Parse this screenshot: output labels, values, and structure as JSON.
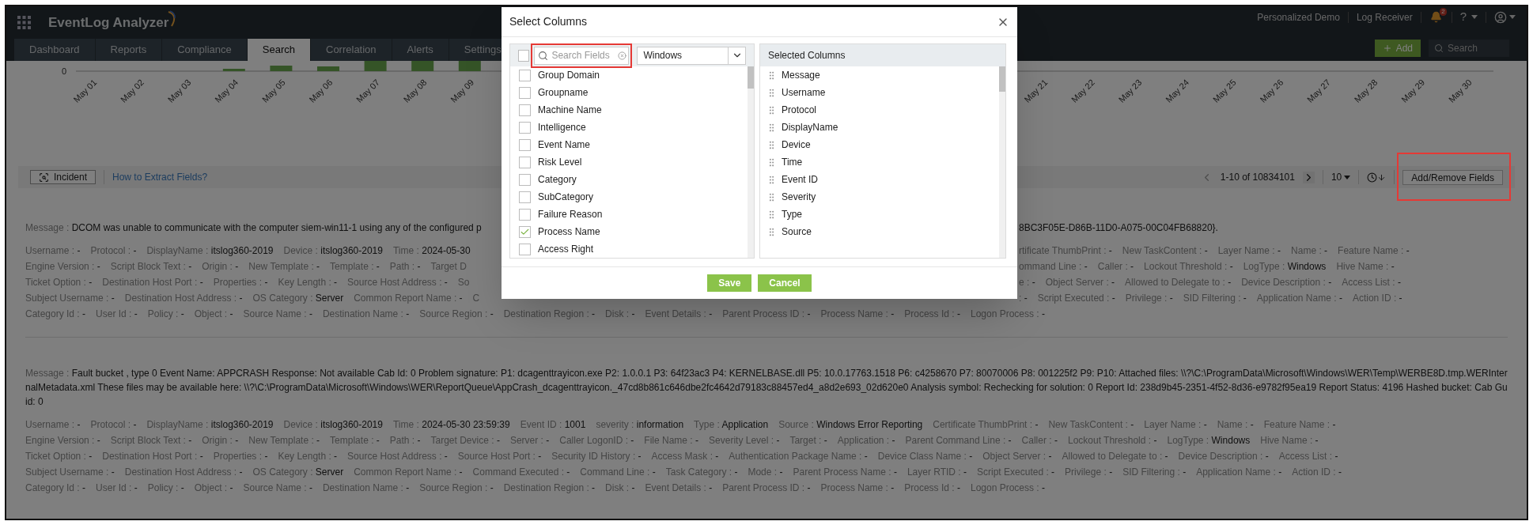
{
  "header": {
    "app_name": "EventLog Analyzer",
    "links": [
      "Personalized Demo",
      "Log Receiver"
    ],
    "notification_badge": "2",
    "help_label": "?",
    "add_button": "Add",
    "search_placeholder": "Search"
  },
  "tabs": [
    {
      "label": "Dashboard",
      "selected": false
    },
    {
      "label": "Reports",
      "selected": false
    },
    {
      "label": "Compliance",
      "selected": false
    },
    {
      "label": "Search",
      "selected": true
    },
    {
      "label": "Correlation",
      "selected": false
    },
    {
      "label": "Alerts",
      "selected": false
    },
    {
      "label": "Settings",
      "selected": false
    }
  ],
  "chart": {
    "zero_label": "0",
    "x_labels_left": [
      "May 01",
      "May 02",
      "May 03",
      "May 04",
      "May 05",
      "May 06",
      "May 07",
      "May 08",
      "May 09"
    ],
    "x_labels_right": [
      "May 21",
      "May 22",
      "May 23",
      "May 24",
      "May 25",
      "May 26",
      "May 27",
      "May 28",
      "May 29",
      "May 30"
    ]
  },
  "results_bar": {
    "incident_button": "Incident",
    "help_link": "How to Extract Fields?",
    "range": "1-10 of 10834101",
    "page_size": "10",
    "add_remove_button": "Add/Remove Fields"
  },
  "records": [
    {
      "message_label": "Message :",
      "message_left": "DCOM was unable to communicate with the computer siem-win11-1 using any of the configured p",
      "message_right": "8BC3F05E-D86B-11D0-A075-00C04FB68820}.",
      "lines": [
        {
          "left": [
            {
              "label": "Username :",
              "value": "-"
            },
            {
              "label": "Protocol :",
              "value": "-"
            },
            {
              "label": "DisplayName :",
              "value": "itslog360-2019"
            },
            {
              "label": "Device :",
              "value": "itslog360-2019"
            },
            {
              "label": "Time :",
              "value": "2024-05-30"
            }
          ],
          "right": [
            {
              "label": "rtificate ThumbPrint :",
              "value": "-"
            },
            {
              "label": "New TaskContent :",
              "value": "-"
            },
            {
              "label": "Layer Name :",
              "value": "-"
            },
            {
              "label": "Name :",
              "value": "-"
            },
            {
              "label": "Feature Name :",
              "value": "-"
            }
          ]
        },
        {
          "left": [
            {
              "label": "Engine Version :",
              "value": "-"
            },
            {
              "label": "Script Block Text :",
              "value": "-"
            },
            {
              "label": "Origin :",
              "value": "-"
            },
            {
              "label": "New Template :",
              "value": "-"
            },
            {
              "label": "Template :",
              "value": "-"
            },
            {
              "label": "Path :",
              "value": "-"
            },
            {
              "label": "Target D"
            }
          ],
          "right": [
            {
              "label": "ommand Line :",
              "value": "-"
            },
            {
              "label": "Caller :",
              "value": "-"
            },
            {
              "label": "Lockout Threshold :",
              "value": "-"
            },
            {
              "label": "LogType :",
              "value": "Windows"
            },
            {
              "label": "Hive Name :",
              "value": "-"
            }
          ]
        },
        {
          "left": [
            {
              "label": "Ticket Option :",
              "value": "-"
            },
            {
              "label": "Destination Host Port :",
              "value": "-"
            },
            {
              "label": "Properties :",
              "value": "-"
            },
            {
              "label": "Key Length :",
              "value": "-"
            },
            {
              "label": "Source Host Address :",
              "value": "-"
            },
            {
              "label": "So"
            }
          ],
          "right": [
            {
              "label": "e :",
              "value": "-"
            },
            {
              "label": "Object Server :",
              "value": "-"
            },
            {
              "label": "Allowed to Delegate to :",
              "value": "-"
            },
            {
              "label": "Device Description :",
              "value": "-"
            },
            {
              "label": "Access List :",
              "value": "-"
            }
          ]
        },
        {
          "left": [
            {
              "label": "Subject Username :",
              "value": "-"
            },
            {
              "label": "Destination Host Address :",
              "value": "-"
            },
            {
              "label": "OS Category :",
              "value": "Server"
            },
            {
              "label": "Common Report Name :",
              "value": "-"
            },
            {
              "label": "C"
            }
          ],
          "right": [
            {
              "label": ":",
              "value": "-"
            },
            {
              "label": "Script Executed :",
              "value": "-"
            },
            {
              "label": "Privilege :",
              "value": "-"
            },
            {
              "label": "SID Filtering :",
              "value": "-"
            },
            {
              "label": "Application Name :",
              "value": "-"
            },
            {
              "label": "Action ID :",
              "value": "-"
            }
          ]
        },
        {
          "left": [
            {
              "label": "Category Id :",
              "value": "-"
            },
            {
              "label": "User Id :",
              "value": "-"
            },
            {
              "label": "Policy :",
              "value": "-"
            },
            {
              "label": "Object :",
              "value": "-"
            },
            {
              "label": "Source Name :",
              "value": "-"
            },
            {
              "label": "Destination Name :",
              "value": "-"
            },
            {
              "label": "Source Region :",
              "value": "-"
            },
            {
              "label": "Destination Region :",
              "value": "-"
            },
            {
              "label": "Disk :",
              "value": "-"
            },
            {
              "label": "Event Details :",
              "value": "-"
            },
            {
              "label": "Parent Process ID :",
              "value": "-"
            },
            {
              "label": "Process Name :",
              "value": "-"
            },
            {
              "label": "Process Id :",
              "value": "-"
            },
            {
              "label": "Logon Process :",
              "value": "-"
            }
          ]
        }
      ]
    },
    {
      "message_label": "Message :",
      "message_left": "Fault bucket , type 0 Event Name: APPCRASH Response: Not available Cab Id: 0 Problem signature: P1: dcagenttrayicon.exe P2: 1.0.0.1 P3: 64f23ac3 P4: KERNELBASE.dll P5: 10.0.17763.1518 P6: c4258670 P7: 80070006 P8: 001225f2 P9: P10: Attached files: \\\\?\\C:\\ProgramData\\Microsoft\\Windows\\WER\\Temp\\WERBE8D.tmp.WERInternalMetadata.xml These files may be available here: \\\\?\\C:\\ProgramData\\Microsoft\\Windows\\WER\\ReportQueue\\AppCrash_dcagenttrayicon._47cd8b861c646dbe2fc4642d79183c88457ed4_a8d2e693_02d620e0 Analysis symbol: Rechecking for solution: 0 Report Id: 238d9b45-2351-4f52-8d36-e9782f95ea19 Report Status: 4196 Hashed bucket: Cab Guid: 0",
      "lines": [
        {
          "left": [
            {
              "label": "Username :",
              "value": "-"
            },
            {
              "label": "Protocol :",
              "value": "-"
            },
            {
              "label": "DisplayName :",
              "value": "itslog360-2019"
            },
            {
              "label": "Device :",
              "value": "itslog360-2019"
            },
            {
              "label": "Time :",
              "value": "2024-05-30 23:59:39"
            },
            {
              "label": "Event ID :",
              "value": "1001"
            },
            {
              "label": "severity :",
              "value": "information"
            },
            {
              "label": "Type :",
              "value": "Application"
            },
            {
              "label": "Source :",
              "value": "Windows Error Reporting"
            },
            {
              "label": "Certificate ThumbPrint :",
              "value": "-"
            },
            {
              "label": "New TaskContent :",
              "value": "-"
            },
            {
              "label": "Layer Name :",
              "value": "-"
            },
            {
              "label": "Name :",
              "value": "-"
            },
            {
              "label": "Feature Name :",
              "value": "-"
            }
          ]
        },
        {
          "left": [
            {
              "label": "Engine Version :",
              "value": "-"
            },
            {
              "label": "Script Block Text :",
              "value": "-"
            },
            {
              "label": "Origin :",
              "value": "-"
            },
            {
              "label": "New Template :",
              "value": "-"
            },
            {
              "label": "Template :",
              "value": "-"
            },
            {
              "label": "Path :",
              "value": "-"
            },
            {
              "label": "Target Device :",
              "value": "-"
            },
            {
              "label": "Server :",
              "value": "-"
            },
            {
              "label": "Caller LogonID :",
              "value": "-"
            },
            {
              "label": "File Name :",
              "value": "-"
            },
            {
              "label": "Severity Level :",
              "value": "-"
            },
            {
              "label": "Target :",
              "value": "-"
            },
            {
              "label": "Application :",
              "value": "-"
            },
            {
              "label": "Parent Command Line :",
              "value": "-"
            },
            {
              "label": "Caller :",
              "value": "-"
            },
            {
              "label": "Lockout Threshold :",
              "value": "-"
            },
            {
              "label": "LogType :",
              "value": "Windows"
            },
            {
              "label": "Hive Name :",
              "value": "-"
            }
          ]
        },
        {
          "left": [
            {
              "label": "Ticket Option :",
              "value": "-"
            },
            {
              "label": "Destination Host Port :",
              "value": "-"
            },
            {
              "label": "Properties :",
              "value": "-"
            },
            {
              "label": "Key Length :",
              "value": "-"
            },
            {
              "label": "Source Host Address :",
              "value": "-"
            },
            {
              "label": "Source Host Port :",
              "value": "-"
            },
            {
              "label": "Security ID History :",
              "value": "-"
            },
            {
              "label": "Access Mask :",
              "value": "-"
            },
            {
              "label": "Authentication Package Name :",
              "value": "-"
            },
            {
              "label": "Device Class Name :",
              "value": "-"
            },
            {
              "label": "Object Server :",
              "value": "-"
            },
            {
              "label": "Allowed to Delegate to :",
              "value": "-"
            },
            {
              "label": "Device Description :",
              "value": "-"
            },
            {
              "label": "Access List :",
              "value": "-"
            }
          ]
        },
        {
          "left": [
            {
              "label": "Subject Username :",
              "value": "-"
            },
            {
              "label": "Destination Host Address :",
              "value": "-"
            },
            {
              "label": "OS Category :",
              "value": "Server"
            },
            {
              "label": "Common Report Name :",
              "value": "-"
            },
            {
              "label": "Command Executed :",
              "value": "-"
            },
            {
              "label": "Command Line :",
              "value": "-"
            },
            {
              "label": "Task Category :",
              "value": "-"
            },
            {
              "label": "Mode :",
              "value": "-"
            },
            {
              "label": "Parent Process Name :",
              "value": "-"
            },
            {
              "label": "Layer RTID :",
              "value": "-"
            },
            {
              "label": "Script Executed :",
              "value": "-"
            },
            {
              "label": "Privilege :",
              "value": "-"
            },
            {
              "label": "SID Filtering :",
              "value": "-"
            },
            {
              "label": "Application Name :",
              "value": "-"
            },
            {
              "label": "Action ID :",
              "value": "-"
            }
          ]
        },
        {
          "left": [
            {
              "label": "Category Id :",
              "value": "-"
            },
            {
              "label": "User Id :",
              "value": "-"
            },
            {
              "label": "Policy :",
              "value": "-"
            },
            {
              "label": "Object :",
              "value": "-"
            },
            {
              "label": "Source Name :",
              "value": "-"
            },
            {
              "label": "Destination Name :",
              "value": "-"
            },
            {
              "label": "Source Region :",
              "value": "-"
            },
            {
              "label": "Destination Region :",
              "value": "-"
            },
            {
              "label": "Disk :",
              "value": "-"
            },
            {
              "label": "Event Details :",
              "value": "-"
            },
            {
              "label": "Parent Process ID :",
              "value": "-"
            },
            {
              "label": "Process Name :",
              "value": "-"
            },
            {
              "label": "Process Id :",
              "value": "-"
            },
            {
              "label": "Logon Process :",
              "value": "-"
            }
          ]
        }
      ]
    }
  ],
  "dialog": {
    "title": "Select Columns",
    "search_placeholder": "Search Fields",
    "source_select": "Windows",
    "select_all_checked": false,
    "selected_header": "Selected Columns",
    "available": [
      {
        "label": "Group Domain",
        "checked": false
      },
      {
        "label": "Groupname",
        "checked": false
      },
      {
        "label": "Machine Name",
        "checked": false
      },
      {
        "label": "Intelligence",
        "checked": false
      },
      {
        "label": "Event Name",
        "checked": false
      },
      {
        "label": "Risk Level",
        "checked": false
      },
      {
        "label": "Category",
        "checked": false
      },
      {
        "label": "SubCategory",
        "checked": false
      },
      {
        "label": "Failure Reason",
        "checked": false
      },
      {
        "label": "Process Name",
        "checked": true
      },
      {
        "label": "Access Right",
        "checked": false
      }
    ],
    "selected": [
      "Message",
      "Username",
      "Protocol",
      "DisplayName",
      "Device",
      "Time",
      "Event ID",
      "Severity",
      "Type",
      "Source"
    ],
    "buttons": [
      "Save",
      "Cancel"
    ]
  }
}
